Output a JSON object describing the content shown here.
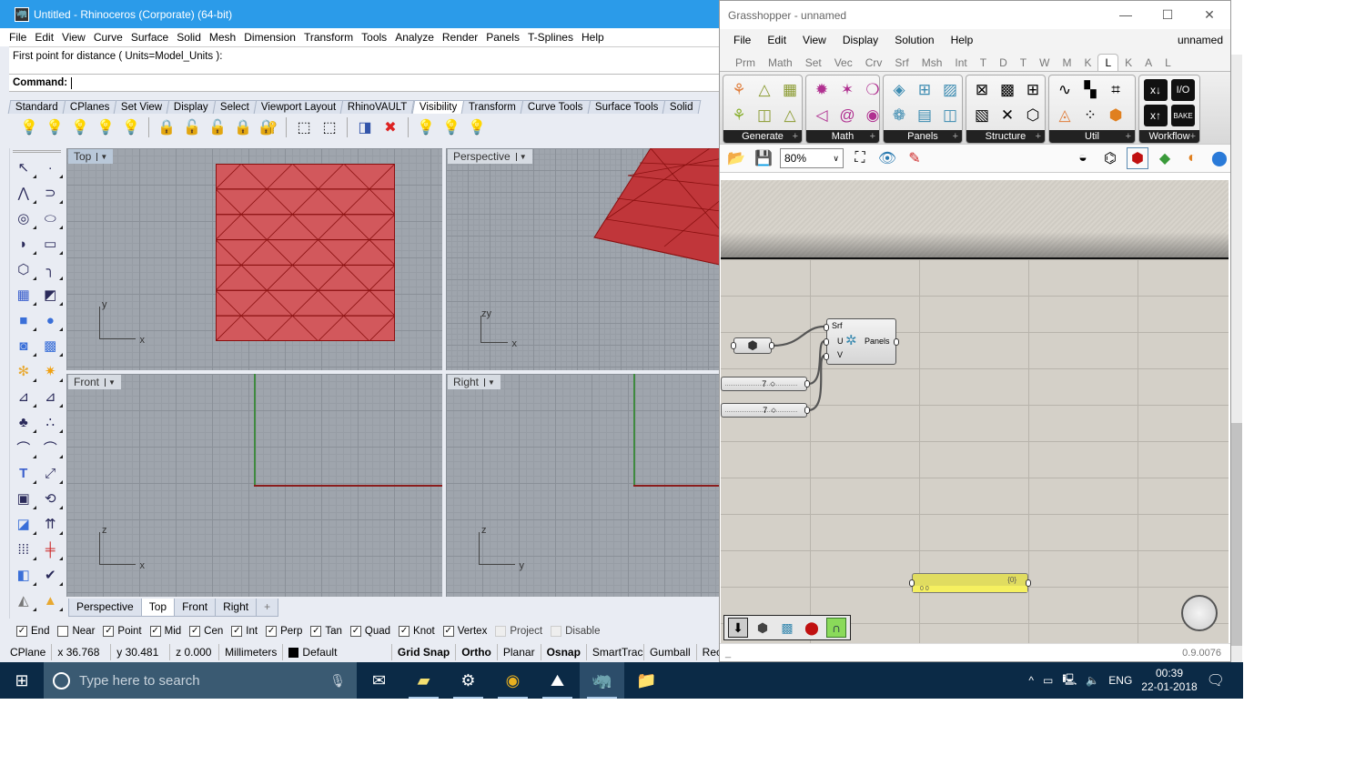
{
  "rhino": {
    "title": "Untitled - Rhinoceros (Corporate) (64-bit)",
    "menu": [
      "File",
      "Edit",
      "View",
      "Curve",
      "Surface",
      "Solid",
      "Mesh",
      "Dimension",
      "Transform",
      "Tools",
      "Analyze",
      "Render",
      "Panels",
      "T-Splines",
      "Help"
    ],
    "command_history": "First point for distance ( Units=Model_Units ):",
    "command_label": "Command:",
    "toolbar_tabs": [
      "Standard",
      "CPlanes",
      "Set View",
      "Display",
      "Select",
      "Viewport Layout",
      "RhinoVAULT",
      "Visibility",
      "Transform",
      "Curve Tools",
      "Surface Tools",
      "Solid"
    ],
    "active_tab": "Visibility",
    "viewports": {
      "top": "Top",
      "perspective": "Perspective",
      "front": "Front",
      "right": "Right"
    },
    "axis_labels": {
      "x": "x",
      "y": "y",
      "z": "z"
    },
    "viewport_tabs": [
      "Perspective",
      "Top",
      "Front",
      "Right"
    ],
    "active_viewport_tab": "Top",
    "add_tab_icon": "+",
    "osnaps": [
      {
        "label": "End",
        "checked": true
      },
      {
        "label": "Near",
        "checked": false
      },
      {
        "label": "Point",
        "checked": true
      },
      {
        "label": "Mid",
        "checked": true
      },
      {
        "label": "Cen",
        "checked": true
      },
      {
        "label": "Int",
        "checked": true
      },
      {
        "label": "Perp",
        "checked": true
      },
      {
        "label": "Tan",
        "checked": true
      },
      {
        "label": "Quad",
        "checked": true
      },
      {
        "label": "Knot",
        "checked": true
      },
      {
        "label": "Vertex",
        "checked": true
      },
      {
        "label": "Project",
        "checked": false,
        "disabled": true
      },
      {
        "label": "Disable",
        "checked": false,
        "disabled": true
      }
    ],
    "status": {
      "cplane": "CPlane",
      "x": "x 36.768",
      "y": "y 30.481",
      "z": "z 0.000",
      "units": "Millimeters",
      "layer": "Default",
      "grid_snap": "Grid Snap",
      "ortho": "Ortho",
      "planar": "Planar",
      "osnap": "Osnap",
      "smarttrack": "SmartTrack",
      "gumball": "Gumball",
      "record": "Rec"
    },
    "surface_color": "#d2585c",
    "panel_grid": {
      "u": 7,
      "v": 7
    }
  },
  "grasshopper": {
    "title": "Grasshopper - unnamed",
    "menu": [
      "File",
      "Edit",
      "View",
      "Display",
      "Solution",
      "Help"
    ],
    "document_name": "unnamed",
    "tabs": [
      "Prm",
      "Math",
      "Set",
      "Vec",
      "Crv",
      "Srf",
      "Msh",
      "Int",
      "T",
      "D",
      "T",
      "W",
      "M",
      "K",
      "L",
      "K",
      "A",
      "L"
    ],
    "active_tab_index": 14,
    "ribbon_groups": [
      "Generate",
      "Math",
      "Panels",
      "Structure",
      "Util",
      "Workflow"
    ],
    "zoom": "80%",
    "components": {
      "panels": {
        "label": "Panels",
        "inputs": [
          "Srf",
          "U",
          "V"
        ]
      },
      "slider_u": {
        "value": "7"
      },
      "slider_v": {
        "value": "7"
      },
      "panel": {
        "path": "{0}",
        "content": "0 0"
      }
    },
    "version": "0.9.0076",
    "status_left": "_"
  },
  "taskbar": {
    "search_placeholder": "Type here to search",
    "language": "ENG",
    "time": "00:39",
    "date": "22-01-2018"
  }
}
